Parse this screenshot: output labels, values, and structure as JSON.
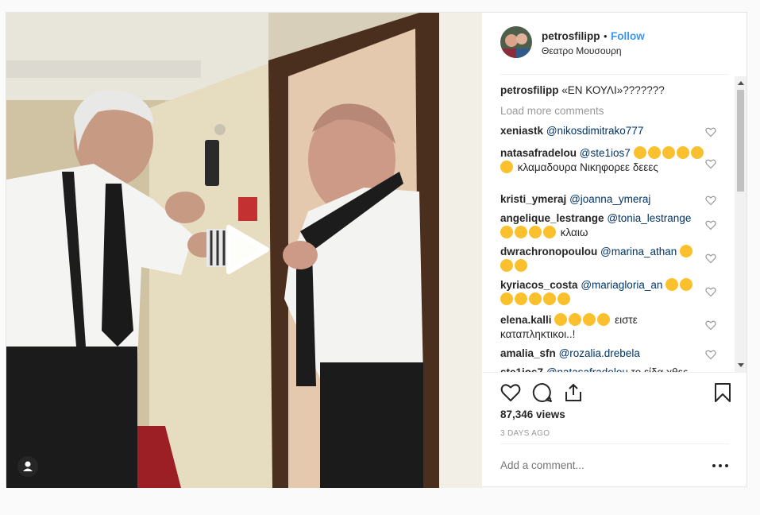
{
  "post": {
    "username": "petrosfilipp",
    "dot": "•",
    "follow_label": "Follow",
    "location": "Θεατρο Μουσουρη",
    "caption": {
      "username": "petrosfilipp",
      "text": "«ΕΝ ΚΟΥΛΙ»???????"
    },
    "load_more": "Load more comments",
    "comments": [
      {
        "user": "xeniastk",
        "mention": "@nikosdimitrako777",
        "text": "",
        "emoji_before": 0,
        "emoji_after": 0
      },
      {
        "user": "natasafradelou",
        "mention": "@ste1ios7",
        "text": "κλαμαδουρα Νικηφορεε δεεες",
        "emoji_before": 6,
        "emoji_after": 0
      },
      {
        "user": "kristi_ymeraj",
        "mention": "@joanna_ymeraj",
        "text": "",
        "emoji_before": 0,
        "emoji_after": 0
      },
      {
        "user": "angelique_lestrange",
        "mention": "@tonia_lestrange",
        "text": "κλαιω",
        "emoji_before": 4,
        "emoji_after": 0
      },
      {
        "user": "dwrachronopoulou",
        "mention": "@marina_athan",
        "text": "",
        "emoji_before": 0,
        "emoji_after": 3
      },
      {
        "user": "kyriacos_costa",
        "mention": "@mariagloria_an",
        "text": "",
        "emoji_before": 0,
        "emoji_after": 7
      },
      {
        "user": "elena.kalli",
        "mention": "",
        "text": "ειστε καταπληκτικοι..!",
        "emoji_before": 4,
        "emoji_after": 0
      },
      {
        "user": "amalia_sfn",
        "mention": "@rozalia.drebela",
        "text": "",
        "emoji_before": 0,
        "emoji_after": 0
      },
      {
        "user": "ste1ios7",
        "mention": "@natasafradelou",
        "text": "το είδα χθες",
        "emoji_before": 0,
        "emoji_after": 0
      }
    ],
    "views": "87,346 views",
    "time": "3 DAYS AGO",
    "add_comment_placeholder": "Add a comment...",
    "accent_color": "#3897f0"
  }
}
